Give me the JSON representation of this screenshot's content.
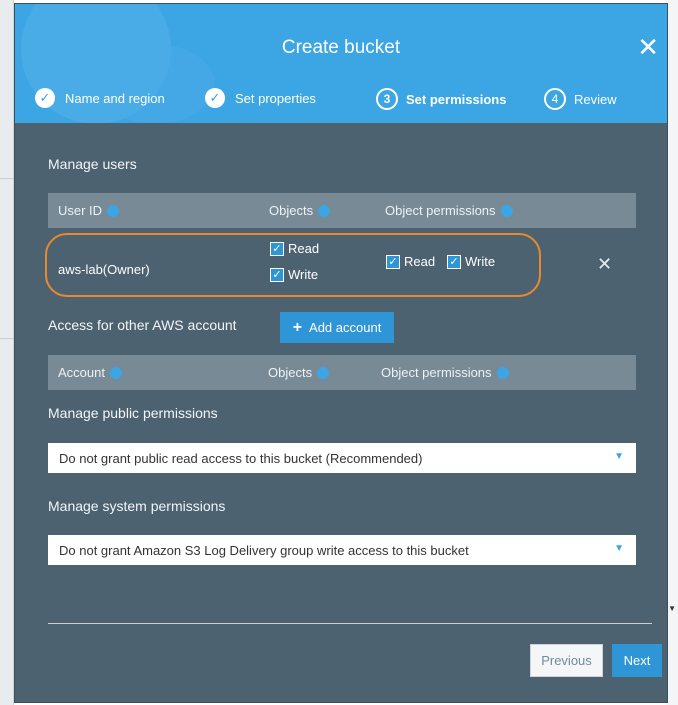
{
  "dialog": {
    "title": "Create bucket",
    "steps": [
      {
        "label": "Name and region",
        "state": "done"
      },
      {
        "label": "Set properties",
        "state": "done"
      },
      {
        "number": "3",
        "label": "Set permissions",
        "state": "active"
      },
      {
        "number": "4",
        "label": "Review",
        "state": "pending"
      }
    ]
  },
  "manage_users": {
    "heading": "Manage users",
    "columns": [
      "User ID",
      "Objects",
      "Object permissions"
    ],
    "owner": {
      "name": "aws-lab(Owner)",
      "objects_read": "Read",
      "objects_write": "Write",
      "perm_read": "Read",
      "perm_write": "Write"
    }
  },
  "other_accounts": {
    "heading": "Access for other AWS account",
    "add_button": "Add account",
    "columns": [
      "Account",
      "Objects",
      "Object permissions"
    ]
  },
  "public_permissions": {
    "heading": "Manage public permissions",
    "selected": "Do not grant public read access to this bucket (Recommended)"
  },
  "system_permissions": {
    "heading": "Manage system permissions",
    "selected": "Do not grant Amazon S3 Log Delivery group write access to this bucket"
  },
  "footer": {
    "previous": "Previous",
    "next": "Next"
  },
  "colors": {
    "header": "#3ca5e4",
    "body": "#4d6270",
    "accent": "#2e96d7",
    "highlight": "#e78a2f"
  }
}
